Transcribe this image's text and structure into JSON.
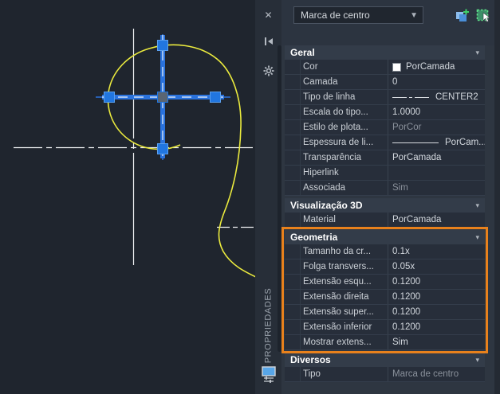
{
  "panel": {
    "title": "PROPRIEDADES",
    "selector_value": "Marca de centro",
    "toolbar_icons": [
      {
        "name": "toggle-pickadd"
      },
      {
        "name": "select-objects"
      },
      {
        "name": "quick-select"
      }
    ]
  },
  "sections": [
    {
      "title": "Geral",
      "rows": [
        {
          "label": "Cor",
          "value": "PorCamada",
          "type": "swatch"
        },
        {
          "label": "Camada",
          "value": "0"
        },
        {
          "label": "Tipo de linha",
          "value": "CENTER2",
          "type": "linetype"
        },
        {
          "label": "Escala do tipo...",
          "value": "1.0000"
        },
        {
          "label": "Estilo de plota...",
          "value": "PorCor",
          "disabled": true
        },
        {
          "label": "Espessura de li...",
          "value": "PorCam...",
          "type": "lineweight"
        },
        {
          "label": "Transparência",
          "value": "PorCamada"
        },
        {
          "label": "Hiperlink",
          "value": ""
        },
        {
          "label": "Associada",
          "value": "Sim",
          "disabled": true
        }
      ]
    },
    {
      "title": "Visualização 3D",
      "rows": [
        {
          "label": "Material",
          "value": "PorCamada"
        }
      ]
    },
    {
      "title": "Geometria",
      "highlighted": true,
      "rows": [
        {
          "label": "Tamanho da cr...",
          "value": "0.1x"
        },
        {
          "label": "Folga transvers...",
          "value": "0.05x"
        },
        {
          "label": "Extensão esqu...",
          "value": "0.1200"
        },
        {
          "label": "Extensão direita",
          "value": "0.1200"
        },
        {
          "label": "Extensão super...",
          "value": "0.1200"
        },
        {
          "label": "Extensão inferior",
          "value": "0.1200"
        },
        {
          "label": "Mostrar extens...",
          "value": "Sim"
        }
      ]
    },
    {
      "title": "Diversos",
      "rows": [
        {
          "label": "Tipo",
          "value": "Marca de centro",
          "disabled": true
        }
      ]
    }
  ],
  "colors": {
    "accent_orange": "#e8811c",
    "grip_blue": "#2176e0",
    "curve_yellow": "#ebeb3e",
    "centerline_white": "#f0f2f4",
    "color_swatch": "#ffffff"
  }
}
